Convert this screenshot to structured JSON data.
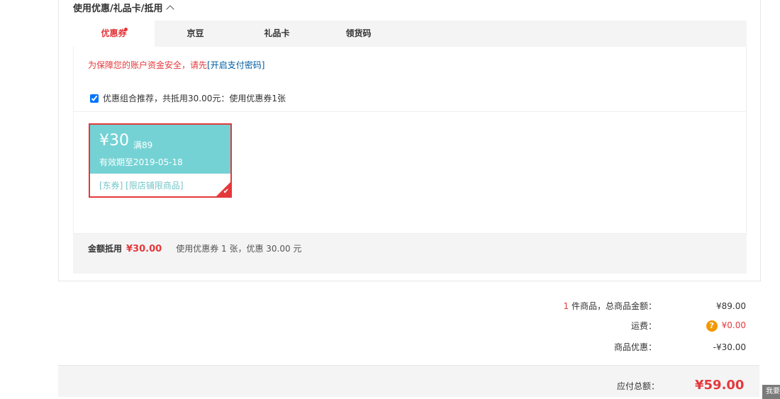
{
  "section": {
    "title": "使用优惠/礼品卡/抵用"
  },
  "tabs": [
    {
      "label": "优惠券",
      "active": true
    },
    {
      "label": "京豆",
      "active": false
    },
    {
      "label": "礼品卡",
      "active": false
    },
    {
      "label": "领货码",
      "active": false
    }
  ],
  "notice": {
    "text": "为保障您的账户资金安全，请先",
    "link": "[开启支付密码]"
  },
  "combo": {
    "checked": true,
    "label": "优惠组合推荐，共抵用30.00元：使用优惠券1张"
  },
  "coupon": {
    "amount": "¥30",
    "condition": "满89",
    "validity": "有效期至2019-05-18",
    "tags": "[东券] [限店铺限商品]"
  },
  "deduction": {
    "label": "金额抵用",
    "value": "¥30.00",
    "desc": "使用优惠券 1 张，优惠 30.00 元"
  },
  "summary": {
    "count": "1",
    "items_label": "件商品，总商品金额：",
    "items_value": "¥89.00",
    "shipping_label": "运费：",
    "shipping_badge": "?",
    "shipping_value": "¥0.00",
    "discount_label": "商品优惠：",
    "discount_value": "-¥30.00"
  },
  "total": {
    "label": "应付总额：",
    "value": "¥59.00"
  },
  "side": {
    "label": "我要"
  },
  "colors": {
    "accent": "#e4393c",
    "coupon": "#74d2d4",
    "link": "#005aa0"
  }
}
